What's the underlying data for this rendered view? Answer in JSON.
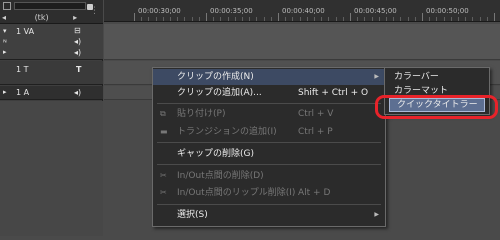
{
  "header": {
    "slider_label": "(tk)",
    "menu_icon": "menu-lines-icon"
  },
  "timeline": {
    "timecodes": [
      "00:00:30;00",
      "00:00:35;00",
      "00:00:40;00",
      "00:00:45;00",
      "00:00:50;00"
    ]
  },
  "tracks": {
    "va": {
      "name": "1 VA",
      "side_glyphs": "▾\n\n▸"
    },
    "t": {
      "name": "1 T"
    },
    "a": {
      "name": "1 A",
      "side_glyph": "▸"
    }
  },
  "context_menu": {
    "items": [
      {
        "label": "クリップの作成(N)",
        "shortcut": "",
        "submenu": true,
        "state": "highlighted"
      },
      {
        "label": "クリップの追加(A)...",
        "shortcut": "Shift + Ctrl + O",
        "submenu": false,
        "state": "enabled"
      },
      {
        "label": "貼り付け(P)",
        "shortcut": "Ctrl + V",
        "submenu": false,
        "state": "disabled",
        "icon": "paste-icon"
      },
      {
        "label": "トランジションの追加(I)",
        "shortcut": "Ctrl + P",
        "submenu": false,
        "state": "disabled",
        "icon": "transition-icon"
      },
      {
        "label": "ギャップの削除(G)",
        "shortcut": "",
        "submenu": false,
        "state": "enabled"
      },
      {
        "label": "In/Out点間の削除(D)",
        "shortcut": "",
        "submenu": false,
        "state": "disabled",
        "icon": "delete-range-icon"
      },
      {
        "label": "In/Out点間のリップル削除(I)",
        "shortcut": "Alt + D",
        "submenu": false,
        "state": "disabled",
        "icon": "ripple-delete-icon"
      },
      {
        "label": "選択(S)",
        "shortcut": "",
        "submenu": true,
        "state": "enabled"
      }
    ]
  },
  "submenu": {
    "items": [
      {
        "label": "カラーバー"
      },
      {
        "label": "カラーマット"
      },
      {
        "label": "クイックタイトラー",
        "selected": true
      }
    ]
  },
  "colors": {
    "highlight": "#3d4a63",
    "selected": "#5d6f92",
    "annotation_ring": "#e8232a"
  }
}
